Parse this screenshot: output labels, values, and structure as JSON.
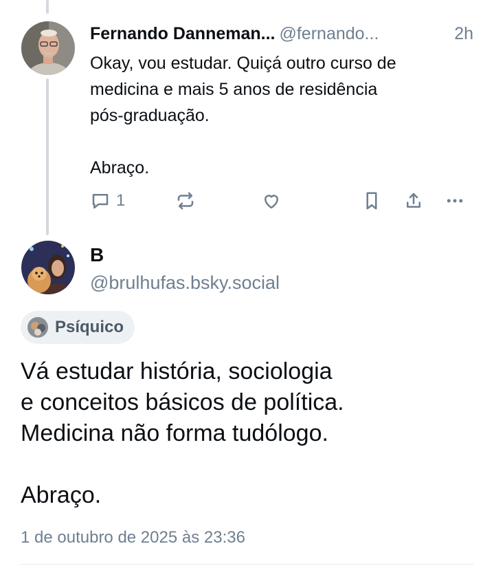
{
  "reply": {
    "author_name": "Fernando Danneman...",
    "author_handle": "@fernando...",
    "time": "2h",
    "body_lines": [
      "Okay, vou estudar. Quiçá outro curso de",
      "medicina e mais 5 anos de residência",
      "pós-graduação."
    ],
    "body_closing": "Abraço.",
    "reply_count": "1",
    "icons": [
      "reply-icon",
      "repost-icon",
      "like-icon",
      "bookmark-icon",
      "share-icon",
      "more-icon"
    ]
  },
  "post": {
    "author_name": "B",
    "author_handle": "@brulhufas.bsky.social",
    "label": "Psíquico",
    "body_lines": [
      "Vá estudar história, sociologia",
      "e conceitos básicos de política.",
      "Medicina não forma tudólogo."
    ],
    "body_closing": "Abraço.",
    "timestamp": "1 de outubro de 2025 às 23:36"
  },
  "colors": {
    "text": "#0b0f14",
    "muted": "#6f7f90",
    "thread_line": "#d4d9df",
    "chip_bg": "#eef1f4"
  }
}
